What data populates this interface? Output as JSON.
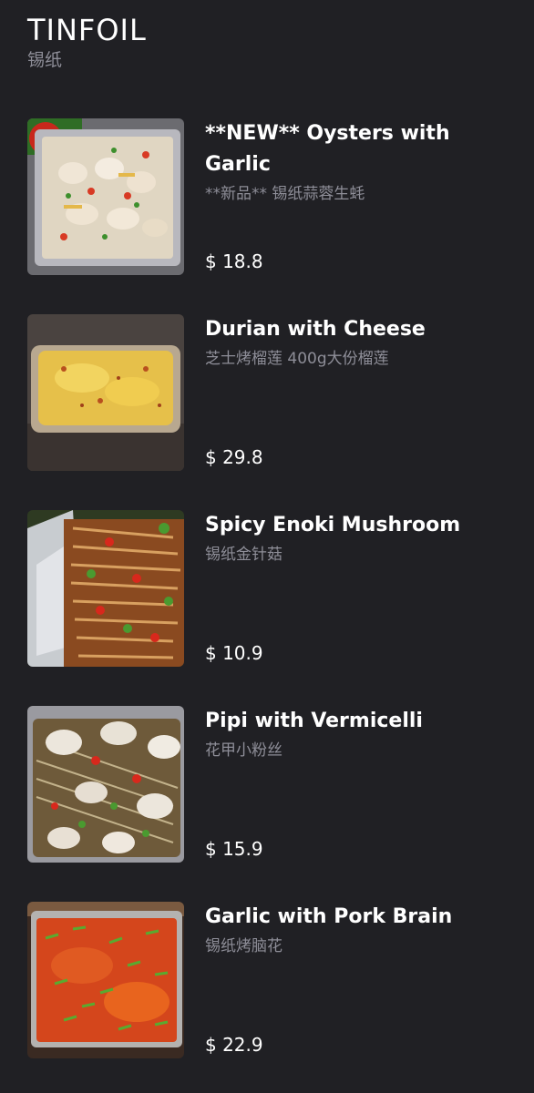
{
  "section": {
    "title": "TINFOIL",
    "subtitle": "锡纸"
  },
  "items": [
    {
      "name": "**NEW** Oysters with Garlic",
      "subtitle": "**新品** 锡纸蒜蓉生蚝",
      "price": "$ 18.8"
    },
    {
      "name": "Durian with Cheese",
      "subtitle": "芝士烤榴莲 400g大份榴莲",
      "price": "$ 29.8"
    },
    {
      "name": "Spicy Enoki Mushroom",
      "subtitle": "锡纸金针菇",
      "price": "$ 10.9"
    },
    {
      "name": "Pipi with Vermicelli",
      "subtitle": "花甲小粉丝",
      "price": "$ 15.9"
    },
    {
      "name": "Garlic with Pork Brain",
      "subtitle": "锡纸烤脑花",
      "price": "$ 22.9"
    }
  ]
}
